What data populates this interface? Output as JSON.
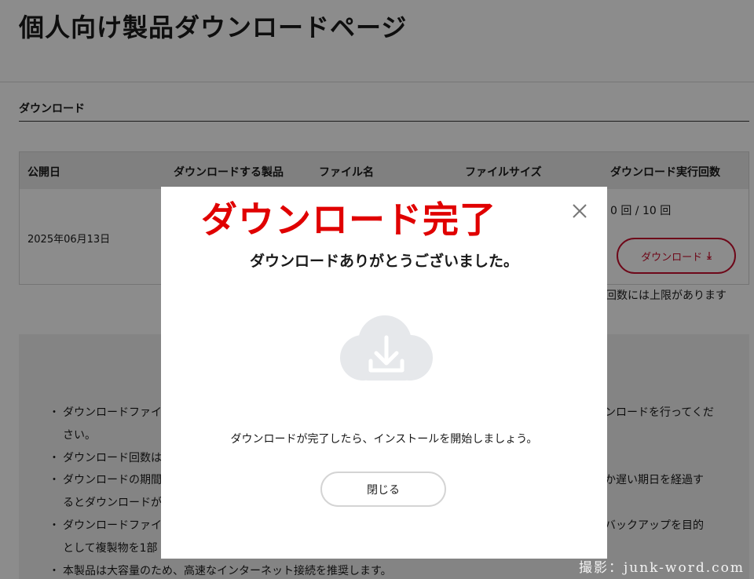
{
  "page": {
    "title": "個人向け製品ダウンロードページ",
    "section_heading": "ダウンロード"
  },
  "table": {
    "headers": [
      "公開日",
      "ダウンロードする製品",
      "ファイル名",
      "ファイルサイズ",
      "ダウンロード実行回数"
    ],
    "row": {
      "date": "2025年06月13日",
      "count": "0 回 / 10 回",
      "download_label": "ダウンロード"
    },
    "limit_note": "ド回数には上限があります"
  },
  "notes": [
    {
      "left": "ダウンロードファイ",
      "right": "ンロードを行ってくだ"
    },
    {
      "continuation": "さい。"
    },
    {
      "left": "ダウンロード回数は"
    },
    {
      "left": "ダウンロードの期間",
      "right": "か遅い期日を経過す"
    },
    {
      "continuation": "るとダウンロードが"
    },
    {
      "left": "ダウンロードファイ",
      "right": "バックアップを目的"
    },
    {
      "continuation": "として複製物を1部"
    },
    {
      "left": "本製品は大容量のため、高速なインターネット接続を推奨します。"
    }
  ],
  "watermark": "撮影：junk-word.com",
  "modal": {
    "title": "ダウンロード完了",
    "thanks": "ダウンロードありがとうございました。",
    "message": "ダウンロードが完了したら、インストールを開始しましょう。",
    "close_button": "閉じる",
    "icons": {
      "close": "close-icon",
      "cloud": "cloud-download-icon"
    }
  },
  "colors": {
    "accent": "#c8102e",
    "modal_title": "#e00000",
    "cloud_icon": "#e6e8eb"
  }
}
